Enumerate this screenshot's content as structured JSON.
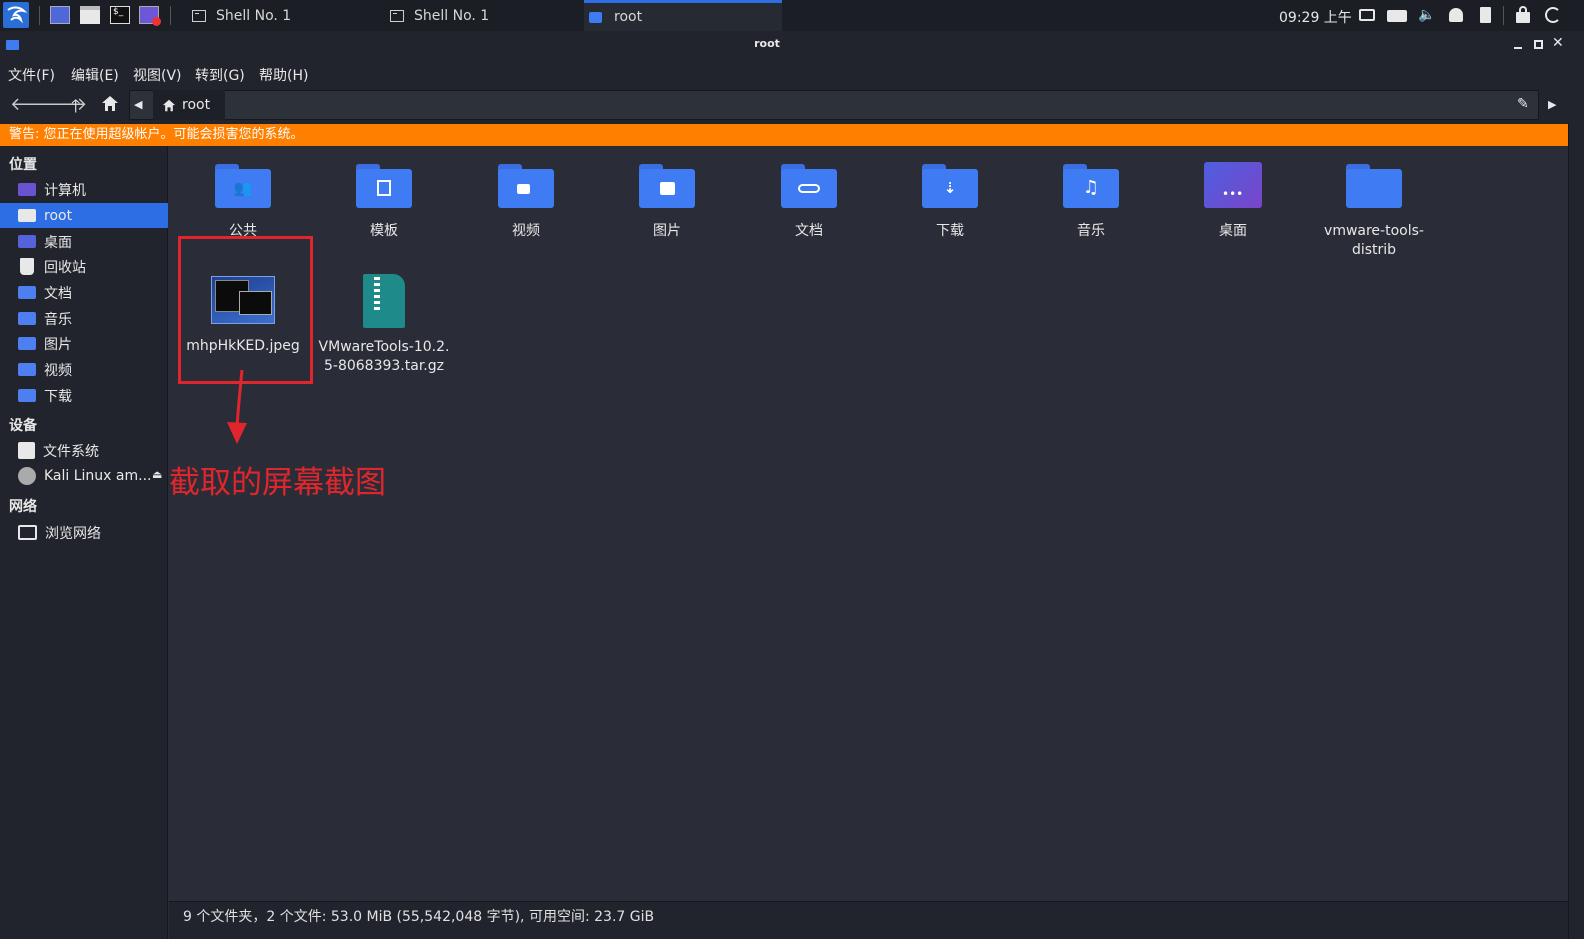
{
  "taskbar": {
    "tasks": [
      {
        "label": "Shell No. 1"
      },
      {
        "label": "Shell No. 1"
      },
      {
        "label": "root"
      }
    ],
    "clock": "09:29 上午"
  },
  "window": {
    "title": "root",
    "menu": [
      "文件(F)",
      "编辑(E)",
      "视图(V)",
      "转到(G)",
      "帮助(H)"
    ],
    "location": "root",
    "warning": "警告: 您正在使用超级帐户。可能会损害您的系统。"
  },
  "sidebar": {
    "places_title": "位置",
    "places": [
      {
        "label": "计算机"
      },
      {
        "label": "root"
      },
      {
        "label": "桌面"
      },
      {
        "label": "回收站"
      },
      {
        "label": "文档"
      },
      {
        "label": "音乐"
      },
      {
        "label": "图片"
      },
      {
        "label": "视频"
      },
      {
        "label": "下载"
      }
    ],
    "devices_title": "设备",
    "devices": [
      {
        "label": "文件系统"
      },
      {
        "label": "Kali Linux am..."
      }
    ],
    "network_title": "网络",
    "network": [
      {
        "label": "浏览网络"
      }
    ]
  },
  "files": [
    {
      "name": "公共",
      "icon": "people-folder-icon"
    },
    {
      "name": "模板",
      "icon": "template-folder-icon"
    },
    {
      "name": "视频",
      "icon": "video-folder-icon"
    },
    {
      "name": "图片",
      "icon": "picture-folder-icon"
    },
    {
      "name": "文档",
      "icon": "document-folder-icon"
    },
    {
      "name": "下载",
      "icon": "download-folder-icon"
    },
    {
      "name": "音乐",
      "icon": "music-folder-icon"
    },
    {
      "name": "桌面",
      "icon": "desktop-folder-icon"
    },
    {
      "name": "vmware-tools-distrib",
      "icon": "folder-icon"
    },
    {
      "name": "mhpHkKED.jpeg",
      "icon": "image-file-icon"
    },
    {
      "name": "VMwareTools-10.2.5-8068393.tar.gz",
      "icon": "archive-file-icon"
    }
  ],
  "annotation": {
    "text": "截取的屏幕截图",
    "color": "#e0262c"
  },
  "status": "9 个文件夹，2 个文件: 53.0 MiB (55,542,048 字节), 可用空间: 23.7 GiB",
  "colors": {
    "accent": "#2e6ee5",
    "warning": "#ff7f00",
    "folder": "#3f7bf2"
  }
}
